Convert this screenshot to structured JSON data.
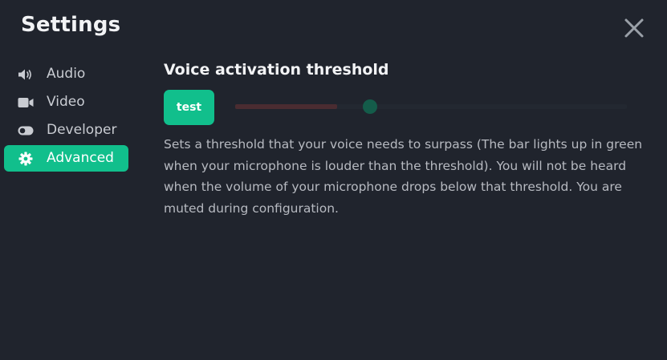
{
  "window": {
    "title": "Settings",
    "close_icon": "close-icon"
  },
  "sidebar": {
    "items": [
      {
        "label": "Audio",
        "icon": "speaker-icon",
        "active": false
      },
      {
        "label": "Video",
        "icon": "video-camera-icon",
        "active": false
      },
      {
        "label": "Developer",
        "icon": "toggle-icon",
        "active": false
      },
      {
        "label": "Advanced",
        "icon": "gear-icon",
        "active": true
      }
    ]
  },
  "main": {
    "section_title": "Voice activation threshold",
    "test_button_label": "test",
    "threshold": {
      "input_level_fraction": 0.26,
      "threshold_fraction": 0.345
    },
    "description": "Sets a threshold that your voice needs to surpass (The bar lights up in green when your microphone is louder than the threshold). You will not be heard when the volume of your microphone drops below that threshold. You are muted during configuration."
  },
  "colors": {
    "background": "#20242d",
    "accent": "#11bf8c",
    "level_bar": "#4a2c31",
    "thumb": "#145c4a",
    "text_primary": "#f2f3f5",
    "text_secondary": "#b7bac1"
  }
}
